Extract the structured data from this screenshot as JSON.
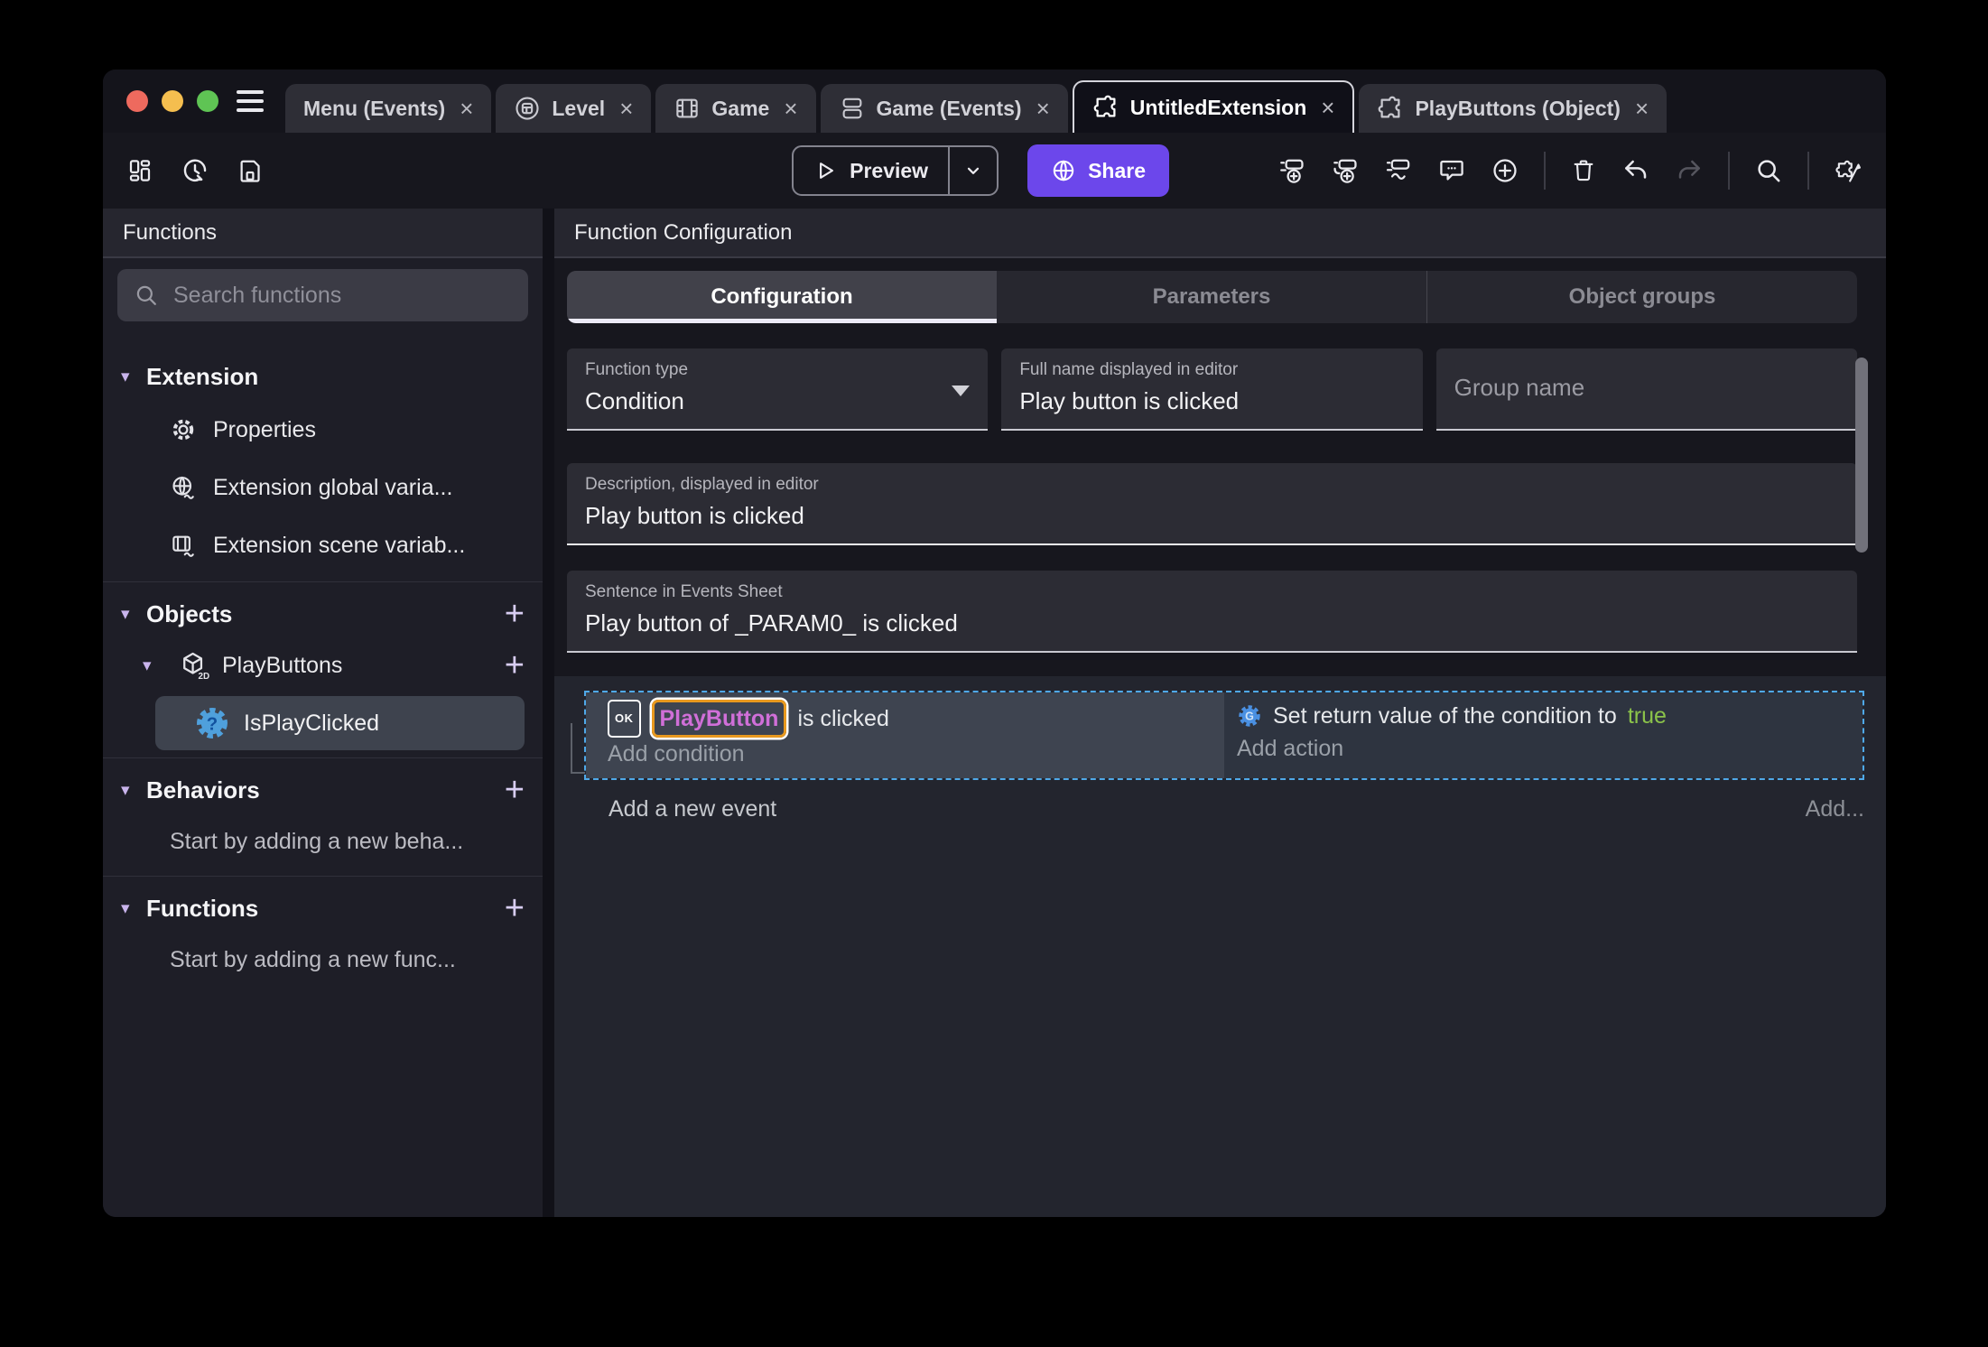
{
  "glyphs": {
    "close": "×",
    "chevron": "▾",
    "plus": "+"
  },
  "window": {
    "tabs": [
      {
        "label": "Menu (Events)"
      },
      {
        "label": "Level"
      },
      {
        "label": "Game"
      },
      {
        "label": "Game (Events)"
      },
      {
        "label": "UntitledExtension",
        "active": true
      },
      {
        "label": "PlayButtons (Object)"
      }
    ]
  },
  "toolbar": {
    "preview_label": "Preview",
    "share_label": "Share"
  },
  "sidebar": {
    "title": "Functions",
    "search_placeholder": "Search functions",
    "extension_section": "Extension",
    "extension_items": [
      {
        "label": "Properties"
      },
      {
        "label": "Extension global varia..."
      },
      {
        "label": "Extension scene variab..."
      }
    ],
    "objects_section": "Objects",
    "object_name": "PlayButtons",
    "object_badge": "2D",
    "selected_function": "IsPlayClicked",
    "behaviors_section": "Behaviors",
    "behaviors_empty": "Start by adding a new beha...",
    "functions_section": "Functions",
    "functions_empty": "Start by adding a new func..."
  },
  "main": {
    "title": "Function Configuration",
    "tabs": [
      {
        "label": "Configuration",
        "active": true
      },
      {
        "label": "Parameters"
      },
      {
        "label": "Object groups"
      }
    ],
    "fields": {
      "function_type_label": "Function type",
      "function_type_value": "Condition",
      "full_name_label": "Full name displayed in editor",
      "full_name_value": "Play button is clicked",
      "group_name_placeholder": "Group name",
      "description_label": "Description, displayed in editor",
      "description_value": "Play button is clicked",
      "sentence_label": "Sentence in Events Sheet",
      "sentence_value": "Play button of _PARAM0_ is clicked"
    },
    "events": {
      "ok_badge": "OK",
      "condition_object": "PlayButton",
      "condition_text": "is clicked",
      "add_condition": "Add condition",
      "action_text": "Set return value of the condition to",
      "action_value": "true",
      "add_action": "Add action",
      "add_new_event": "Add a new event",
      "add_button": "Add..."
    }
  },
  "colors": {
    "accent_purple": "#6C47EB",
    "selection_blue": "#4FA9E9",
    "object_chip_text": "#D06FD8",
    "object_chip_border": "#E8991F",
    "boolean_true_green": "#8BC34A",
    "action_icon_blue": "#4A90E2",
    "condition_icon_blue": "#4FA0DC"
  }
}
